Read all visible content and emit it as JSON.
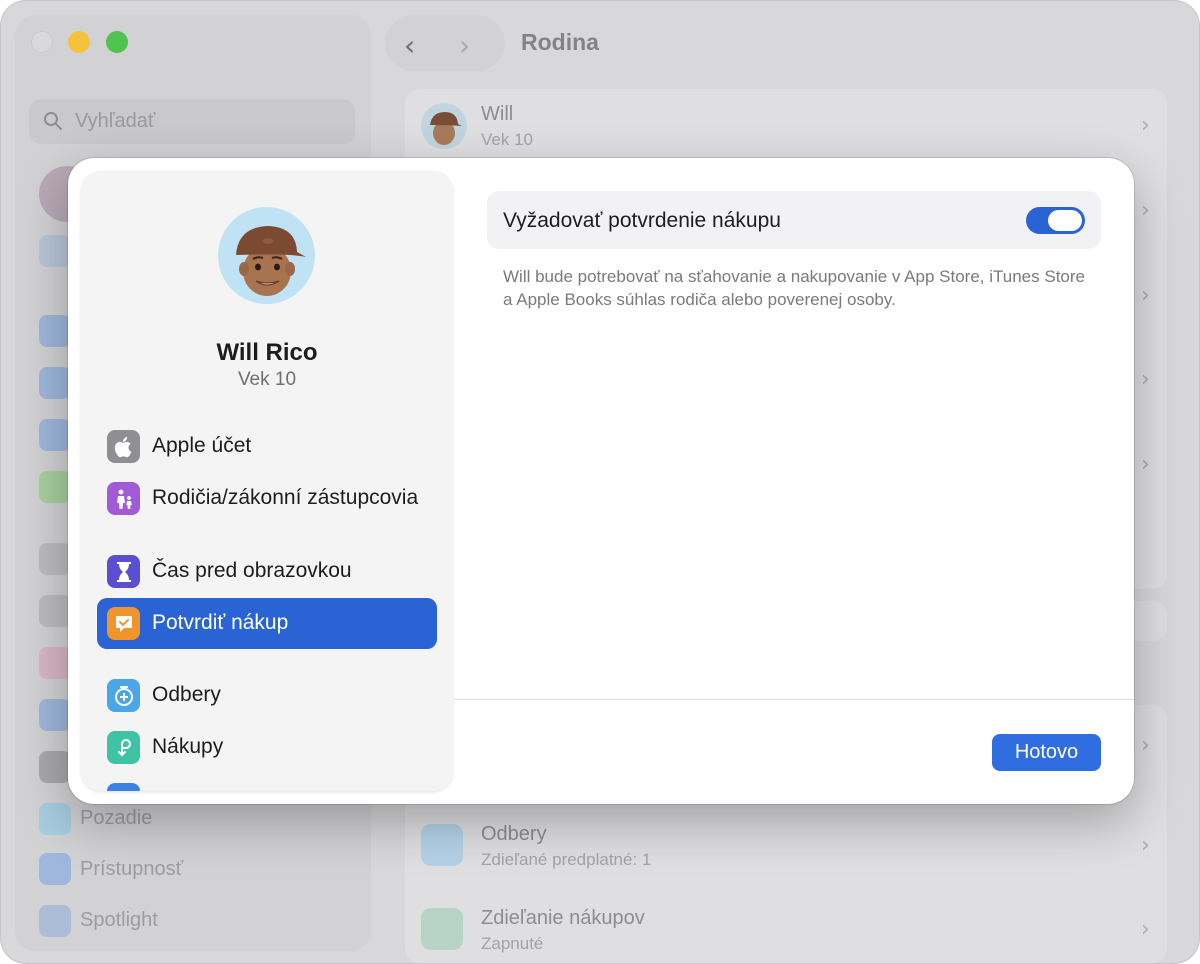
{
  "window": {
    "search_placeholder": "Vyhľadať",
    "title": "Rodina",
    "back_glyph": "‹",
    "forward_glyph": "›",
    "sidebar_bottom_items": [
      "Pozadie",
      "Prístupnosť",
      "Spotlight"
    ]
  },
  "background_list": {
    "member": {
      "name": "Will",
      "age": "Vek 10"
    },
    "subscriptions": {
      "title": "Odbery",
      "subtitle": "Zdieľané predplatné: 1"
    },
    "purchase_sharing": {
      "title": "Zdieľanie nákupov",
      "subtitle": "Zapnuté"
    }
  },
  "dialog": {
    "profile": {
      "name": "Will Rico",
      "age": "Vek 10"
    },
    "menu": [
      {
        "label": "Apple účet",
        "icon": "apple-logo-icon",
        "color": "#8e8e93"
      },
      {
        "label": "Rodičia/zákonní zástupcovia",
        "icon": "parent-child-icon",
        "color": "#a05cd6"
      },
      {
        "label": "Čas pred obrazovkou",
        "icon": "hourglass-icon",
        "color": "#5a4fd0"
      },
      {
        "label": "Potvrdiť nákup",
        "icon": "ask-to-buy-icon",
        "color": "#f0952c",
        "selected": true
      },
      {
        "label": "Odbery",
        "icon": "subscriptions-icon",
        "color": "#4aa6e6"
      },
      {
        "label": "Nákupy",
        "icon": "purchases-icon",
        "color": "#3ec3a5"
      }
    ],
    "setting": {
      "label": "Vyžadovať potvrdenie nákupu",
      "enabled": true,
      "description": "Will bude potrebovať na sťahovanie a nakupovanie v App Store, iTunes Store a Apple Books súhlas rodiča alebo poverenej osoby."
    },
    "done_label": "Hotovo"
  },
  "colors": {
    "accent": "#2a63d4",
    "toggle_on": "#2a63d4"
  }
}
